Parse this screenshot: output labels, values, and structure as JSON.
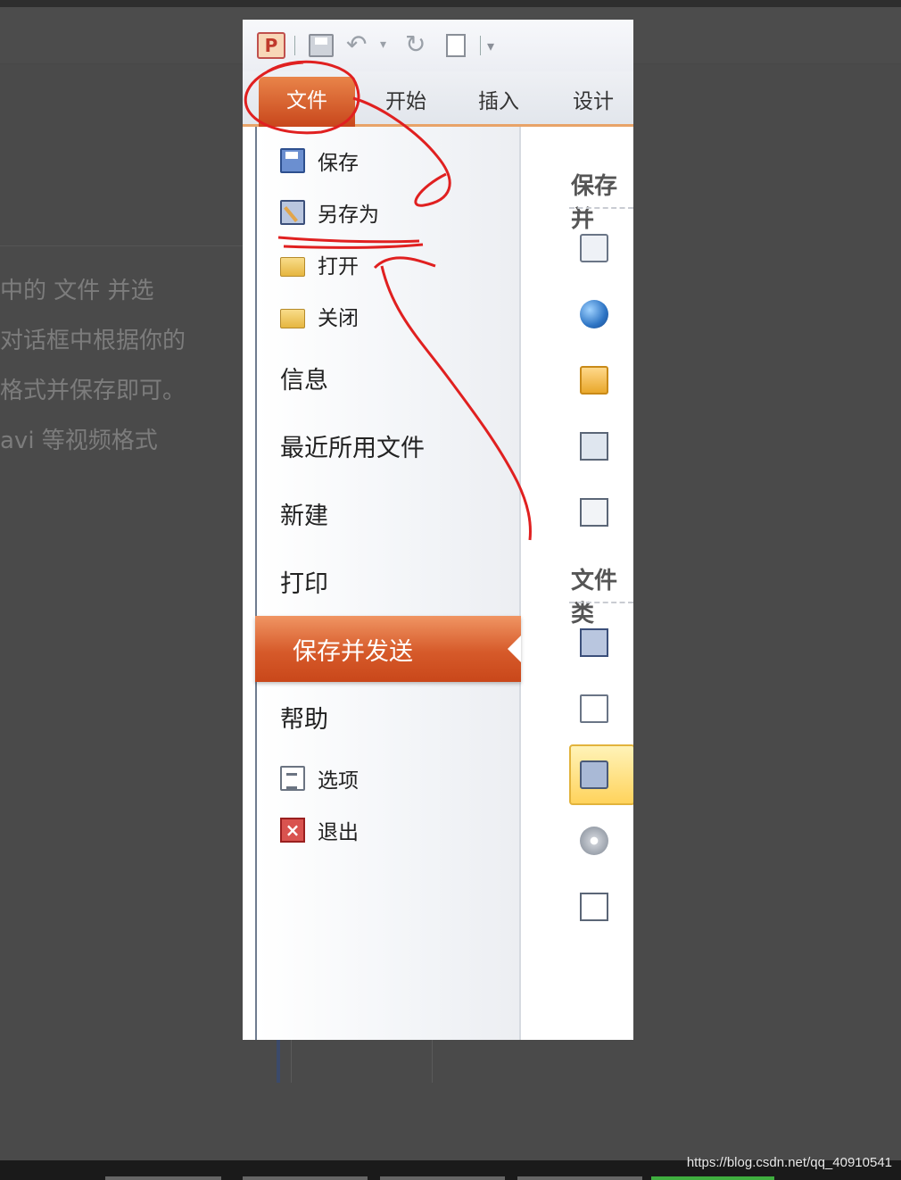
{
  "background_article": {
    "lines": [
      "中的 文件 并选",
      "对话框中根据你的",
      "格式并保存即可。",
      "avi 等视频格式"
    ]
  },
  "watermark": "https://blog.csdn.net/qq_40910541",
  "ribbon": {
    "app_icon": "P",
    "tabs": [
      {
        "label": "文件",
        "active": true
      },
      {
        "label": "开始"
      },
      {
        "label": "插入"
      },
      {
        "label": "设计"
      }
    ]
  },
  "backstage": {
    "small_items": [
      {
        "label": "保存",
        "icon": "save-icon"
      },
      {
        "label": "另存为",
        "icon": "save-as-icon"
      },
      {
        "label": "打开",
        "icon": "open-folder-icon"
      },
      {
        "label": "关闭",
        "icon": "close-folder-icon"
      }
    ],
    "big_items": [
      {
        "label": "信息"
      },
      {
        "label": "最近所用文件"
      },
      {
        "label": "新建"
      },
      {
        "label": "打印"
      }
    ],
    "active_item": "保存并发送",
    "help": "帮助",
    "bottom_items": [
      {
        "label": "选项",
        "icon": "options-icon"
      },
      {
        "label": "退出",
        "icon": "exit-icon"
      }
    ]
  },
  "right_panel": {
    "heading_1": "保存并",
    "heading_2": "文件类",
    "partial_text": "件类"
  },
  "colors": {
    "accent_orange": "#d65a2a",
    "annotation_red": "#e02020",
    "highlight_yellow": "#ffd35c"
  }
}
